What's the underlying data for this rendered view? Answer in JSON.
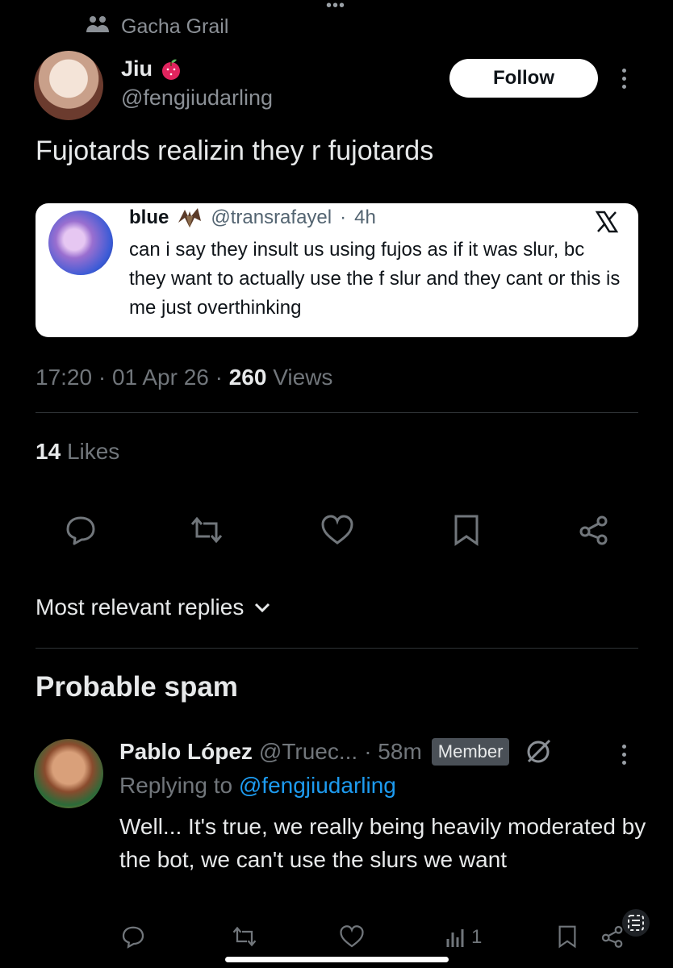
{
  "community": {
    "name": "Gacha Grail"
  },
  "author": {
    "name": "Jiu",
    "handle": "@fengjiudarling"
  },
  "follow_label": "Follow",
  "post": {
    "text": "Fujotards realizin they r fujotards"
  },
  "quote": {
    "name": "blue",
    "handle": "@transrafayel",
    "sep": "·",
    "time": "4h",
    "text": "can i say they insult us using fujos as if it was slur, bc they want to actually use the f slur and they cant or this is me just overthinking"
  },
  "meta": {
    "time": "17:20",
    "date": "01 Apr 26",
    "views_count": "260",
    "views_label": "Views"
  },
  "likes": {
    "count": "14",
    "label": "Likes"
  },
  "sort_label": "Most relevant replies",
  "spam_section": {
    "title": "Probable spam"
  },
  "reply": {
    "name": "Pablo López",
    "handle": "@Truec...",
    "time": "· 58m",
    "badge": "Member",
    "replying_prefix": "Replying to",
    "replying_handle": "@fengjiudarling",
    "text": "Well... It's true, we really being heavily moderated by the bot, we can't use the slurs we want",
    "views": "1"
  },
  "icons": [
    "community-icon",
    "apple-emoji-icon",
    "more-icon",
    "bat-emoji-icon",
    "x-logo-icon",
    "reply-icon",
    "retweet-icon",
    "like-icon",
    "bookmark-icon",
    "share-icon",
    "chevron-down-icon",
    "crossed-circle-icon",
    "views-icon",
    "grok-icon"
  ]
}
